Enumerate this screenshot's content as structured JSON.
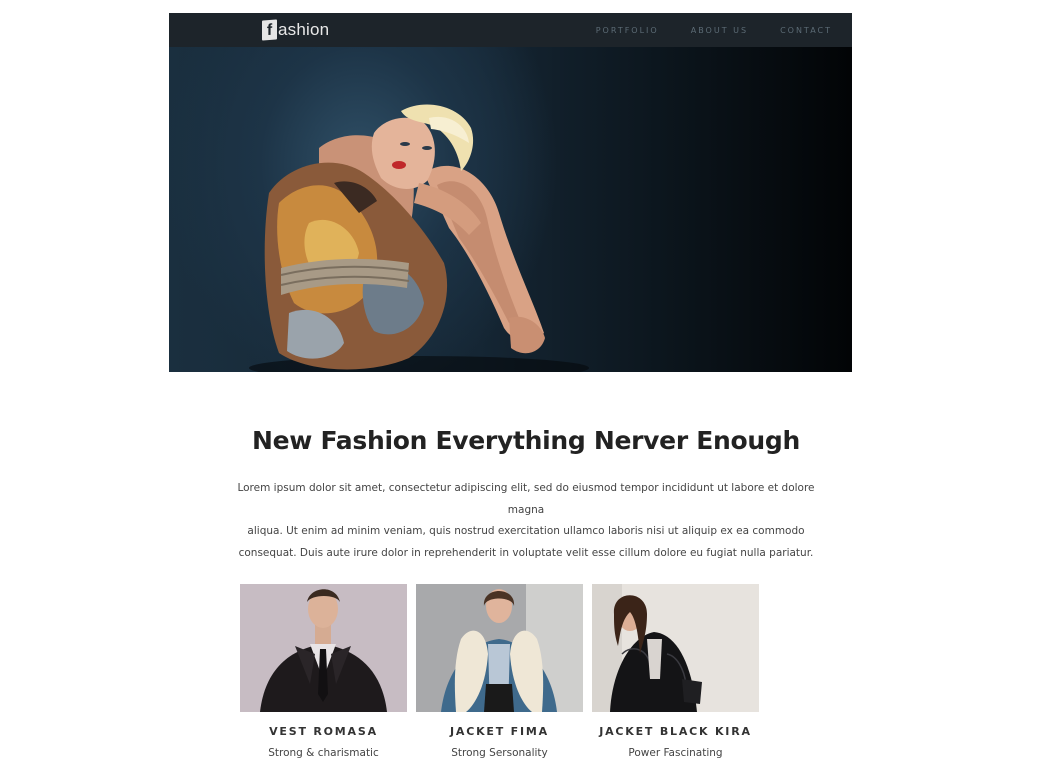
{
  "brand": {
    "logo_letter": "f",
    "logo_rest": "ashion"
  },
  "nav": {
    "items": [
      "PORTFOLIO",
      "ABOUT US",
      "CONTACT"
    ]
  },
  "hero": {
    "image": "fashion-model-hero-photo"
  },
  "intro": {
    "headline": "New Fashion Everything Nerver Enough",
    "lines": [
      "Lorem ipsum dolor sit amet, consectetur adipiscing elit, sed do eiusmod tempor incididunt ut labore et dolore magna",
      "aliqua. Ut enim ad minim veniam, quis nostrud exercitation ullamco laboris nisi ut aliquip ex ea commodo",
      "consequat. Duis aute irure dolor in reprehenderit in voluptate velit esse cillum dolore eu fugiat nulla pariatur."
    ]
  },
  "products": [
    {
      "name": "VEST ROMASA",
      "subtitle": "Strong & charismatic"
    },
    {
      "name": "JACKET FIMA",
      "subtitle": "Strong Sersonality"
    },
    {
      "name": "JACKET BLACK KIRA",
      "subtitle": "Power Fascinating"
    }
  ],
  "colors": {
    "header_bg": "#1d242a",
    "nav_text": "#5c6b75",
    "heading": "#222222"
  }
}
